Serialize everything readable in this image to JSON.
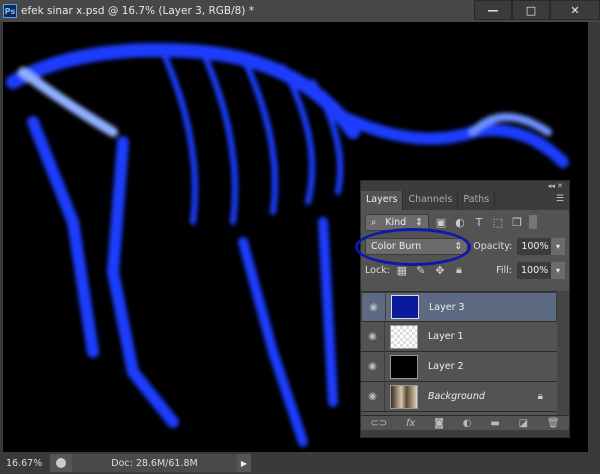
{
  "window": {
    "app_icon": "Ps",
    "title": "efek sinar x.psd @ 16.7% (Layer 3, RGB/8) *",
    "minimize": "—",
    "maximize": "□",
    "close": "✕"
  },
  "status": {
    "zoom": "16.67%",
    "doc": "Doc: 28.6M/61.8M"
  },
  "panel": {
    "collapse": "◂◂ ✕",
    "tabs": [
      "Layers",
      "Channels",
      "Paths"
    ],
    "filter": "Kind",
    "blend_mode": "Color Burn",
    "opacity_label": "Opacity:",
    "opacity": "100%",
    "lock_label": "Lock:",
    "fill_label": "Fill:",
    "fill": "100%",
    "layers": [
      {
        "name": "Layer 3",
        "thumb": "#0a1a9a",
        "selected": true
      },
      {
        "name": "Layer 1",
        "thumb": "checker"
      },
      {
        "name": "Layer 2",
        "thumb": "#000000"
      },
      {
        "name": "Background",
        "thumb": "photo",
        "locked": true
      }
    ]
  },
  "colors": {
    "annotation": "#0a1ab0",
    "skeleton": "#1a3cff"
  }
}
